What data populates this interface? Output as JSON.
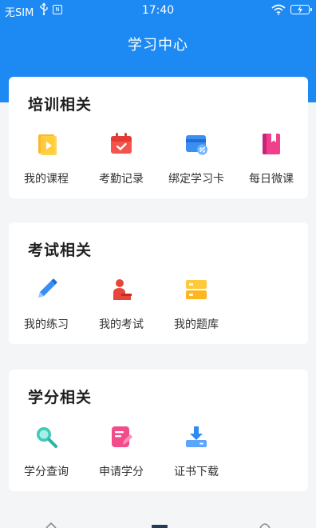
{
  "status_bar": {
    "carrier": "无SIM",
    "time": "17:40",
    "chip_label": "N"
  },
  "header": {
    "title": "学习中心"
  },
  "sections": [
    {
      "title": "培训相关",
      "items": [
        {
          "label": "我的课程",
          "icon": "course-video-icon"
        },
        {
          "label": "考勤记录",
          "icon": "attendance-calendar-icon"
        },
        {
          "label": "绑定学习卡",
          "icon": "bind-card-icon"
        },
        {
          "label": "每日微课",
          "icon": "daily-book-icon"
        }
      ]
    },
    {
      "title": "考试相关",
      "items": [
        {
          "label": "我的练习",
          "icon": "pencil-icon"
        },
        {
          "label": "我的考试",
          "icon": "exam-person-icon"
        },
        {
          "label": "我的题库",
          "icon": "question-bank-icon"
        }
      ]
    },
    {
      "title": "学分相关",
      "items": [
        {
          "label": "学分查询",
          "icon": "search-icon"
        },
        {
          "label": "申请学分",
          "icon": "apply-document-icon"
        },
        {
          "label": "证书下载",
          "icon": "download-tray-icon"
        }
      ]
    }
  ],
  "colors": {
    "header_blue": "#1d89f3",
    "page_bg": "#f4f5f7"
  }
}
